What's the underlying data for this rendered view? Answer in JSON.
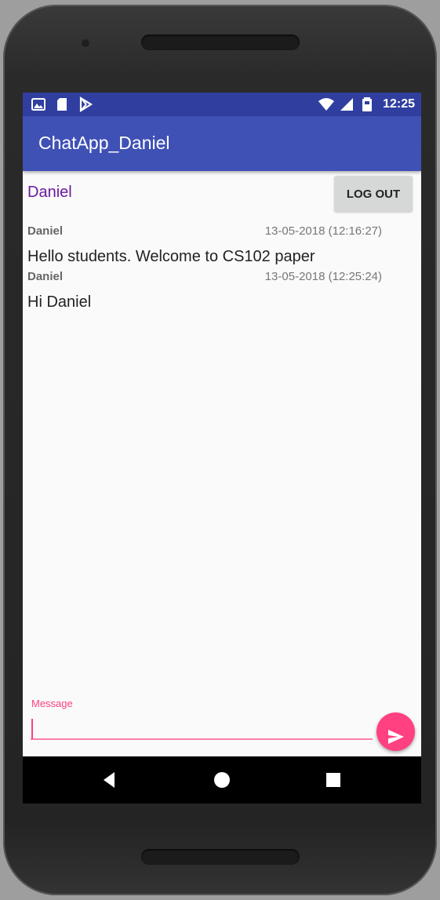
{
  "status_bar": {
    "time": "12:25",
    "left_icons": [
      "image-icon",
      "sd-card-icon",
      "play-store-icon"
    ],
    "right_icons": [
      "wifi-icon",
      "signal-icon",
      "battery-icon"
    ]
  },
  "app_bar": {
    "title": "ChatApp_Daniel"
  },
  "user": {
    "name": "Daniel",
    "logout_label": "LOG OUT"
  },
  "messages": [
    {
      "user": "Daniel",
      "time": "13-05-2018 (12:16:27)",
      "text": "Hello students. Welcome to CS102 paper"
    },
    {
      "user": "Daniel",
      "time": "13-05-2018 (12:25:24)",
      "text": "Hi Daniel"
    }
  ],
  "composer": {
    "label": "Message",
    "value": "",
    "send_icon": "send-icon"
  },
  "nav_bar": {
    "icons": [
      "back-icon",
      "home-icon",
      "recents-icon"
    ]
  },
  "colors": {
    "status_bar": "#303f9f",
    "app_bar": "#3f51b5",
    "accent": "#ff4081",
    "username": "#6a1b9a"
  }
}
